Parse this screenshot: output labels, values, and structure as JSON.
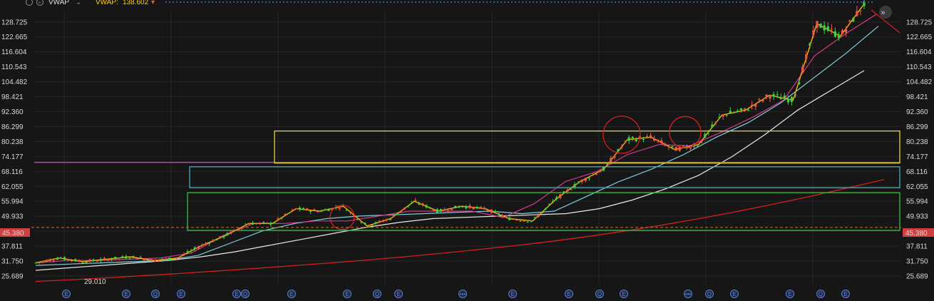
{
  "header": {
    "indicator_label": "VWAP",
    "vwap_label": "VWAP:",
    "vwap_value": "138.602"
  },
  "colors": {
    "background": "#161616",
    "grid": "#262626",
    "up": "#3fd13f",
    "down": "#f05a4a",
    "ma_fast": "#ffb000",
    "ma_pink": "#d63a8c",
    "ma_cyan": "#7fd0e0",
    "ma_white": "#e8e8e8",
    "ma_red": "#d42020",
    "box_yellow": "#e6d23a",
    "box_cyan": "#3fb0c0",
    "box_green": "#3fc040",
    "line_magenta": "#c040c0",
    "circle_red": "#e02020",
    "price_tag": "#d04040",
    "event_icon": "#5a7fd6"
  },
  "chart_data": {
    "type": "candlestick",
    "y_axis_labels": [
      "128.725",
      "122.665",
      "116.604",
      "110.543",
      "104.482",
      "98.421",
      "92.360",
      "86.299",
      "80.238",
      "74.177",
      "68.116",
      "62.055",
      "55.994",
      "49.933",
      "43.872",
      "37.811",
      "31.750",
      "25.689"
    ],
    "ylim": [
      22.5,
      133
    ],
    "current_price_tag": "45.380",
    "current_price_value": 45.38,
    "min_label": "29.010",
    "min_value": 29.01,
    "event_markers": [
      "E",
      "E",
      "Q",
      "E",
      "E",
      "Q",
      "E",
      "E",
      "Q",
      "E",
      "•••",
      "E",
      "E",
      "Q",
      "E",
      "•••",
      "Q",
      "E",
      "E",
      "Q",
      "E"
    ],
    "series": [
      {
        "name": "",
        "role": "ma_red",
        "y": [
          23.5,
          24.2,
          25.0,
          25.9,
          26.8,
          27.8,
          28.8,
          29.9,
          31.0,
          32.2,
          33.5,
          34.9,
          36.4,
          38.0,
          39.8,
          41.8,
          44.0,
          46.4,
          49.0,
          51.8,
          54.8,
          58.0,
          61.4,
          64.8
        ]
      },
      {
        "name": "",
        "role": "ma_white",
        "y": [
          28.0,
          29.0,
          30.0,
          31.0,
          32.0,
          33.5,
          35.5,
          38.0,
          40.5,
          43.0,
          45.5,
          47.5,
          49.0,
          49.5,
          50.0,
          50.5,
          51.0,
          53.0,
          56.5,
          61.0,
          66.5,
          74.0,
          83.0,
          93.0,
          101.0,
          109.0
        ]
      },
      {
        "name": "",
        "role": "ma_cyan",
        "y": [
          30.0,
          30.5,
          31.0,
          31.5,
          32.0,
          34.0,
          39.0,
          44.0,
          47.0,
          49.0,
          50.0,
          50.5,
          51.0,
          51.5,
          52.0,
          51.0,
          52.0,
          58.0,
          64.0,
          69.0,
          75.0,
          82.0,
          88.0,
          96.0,
          106.0,
          116.0,
          127.0
        ]
      },
      {
        "name": "",
        "role": "ma_pink",
        "y": [
          31.0,
          32.0,
          32.0,
          32.5,
          33.0,
          35.0,
          42.0,
          47.0,
          47.0,
          48.0,
          48.0,
          50.0,
          52.0,
          52.0,
          52.0,
          49.5,
          55.0,
          64.0,
          68.0,
          75.0,
          79.0,
          78.5,
          84.0,
          90.0,
          97.0,
          115.0,
          124.0,
          132.0
        ]
      },
      {
        "name": "",
        "role": "price",
        "y": [
          31.0,
          33.0,
          31.5,
          32.5,
          33.5,
          32.0,
          33.0,
          38.0,
          42.0,
          47.0,
          47.0,
          53.0,
          52.0,
          54.0,
          46.0,
          49.0,
          56.0,
          52.0,
          54.0,
          53.0,
          49.0,
          48.0,
          57.0,
          64.0,
          69.0,
          81.0,
          82.0,
          77.0,
          79.0,
          91.0,
          93.0,
          99.0,
          97.0,
          128.0,
          123.0,
          136.0
        ]
      }
    ],
    "boxes": [
      {
        "role": "box_yellow",
        "y_top": 84.5,
        "y_bottom": 71.5
      },
      {
        "role": "box_cyan",
        "y_top": 70.0,
        "y_bottom": 61.5
      },
      {
        "role": "box_green",
        "y_top": 59.5,
        "y_bottom": 44.2
      }
    ],
    "horizontal_line": {
      "role": "line_magenta",
      "y": 71.8
    },
    "circles": [
      {
        "y": 49.5
      },
      {
        "y": 83.0
      },
      {
        "y": 84.0
      }
    ],
    "grid": true,
    "legend": "none"
  }
}
